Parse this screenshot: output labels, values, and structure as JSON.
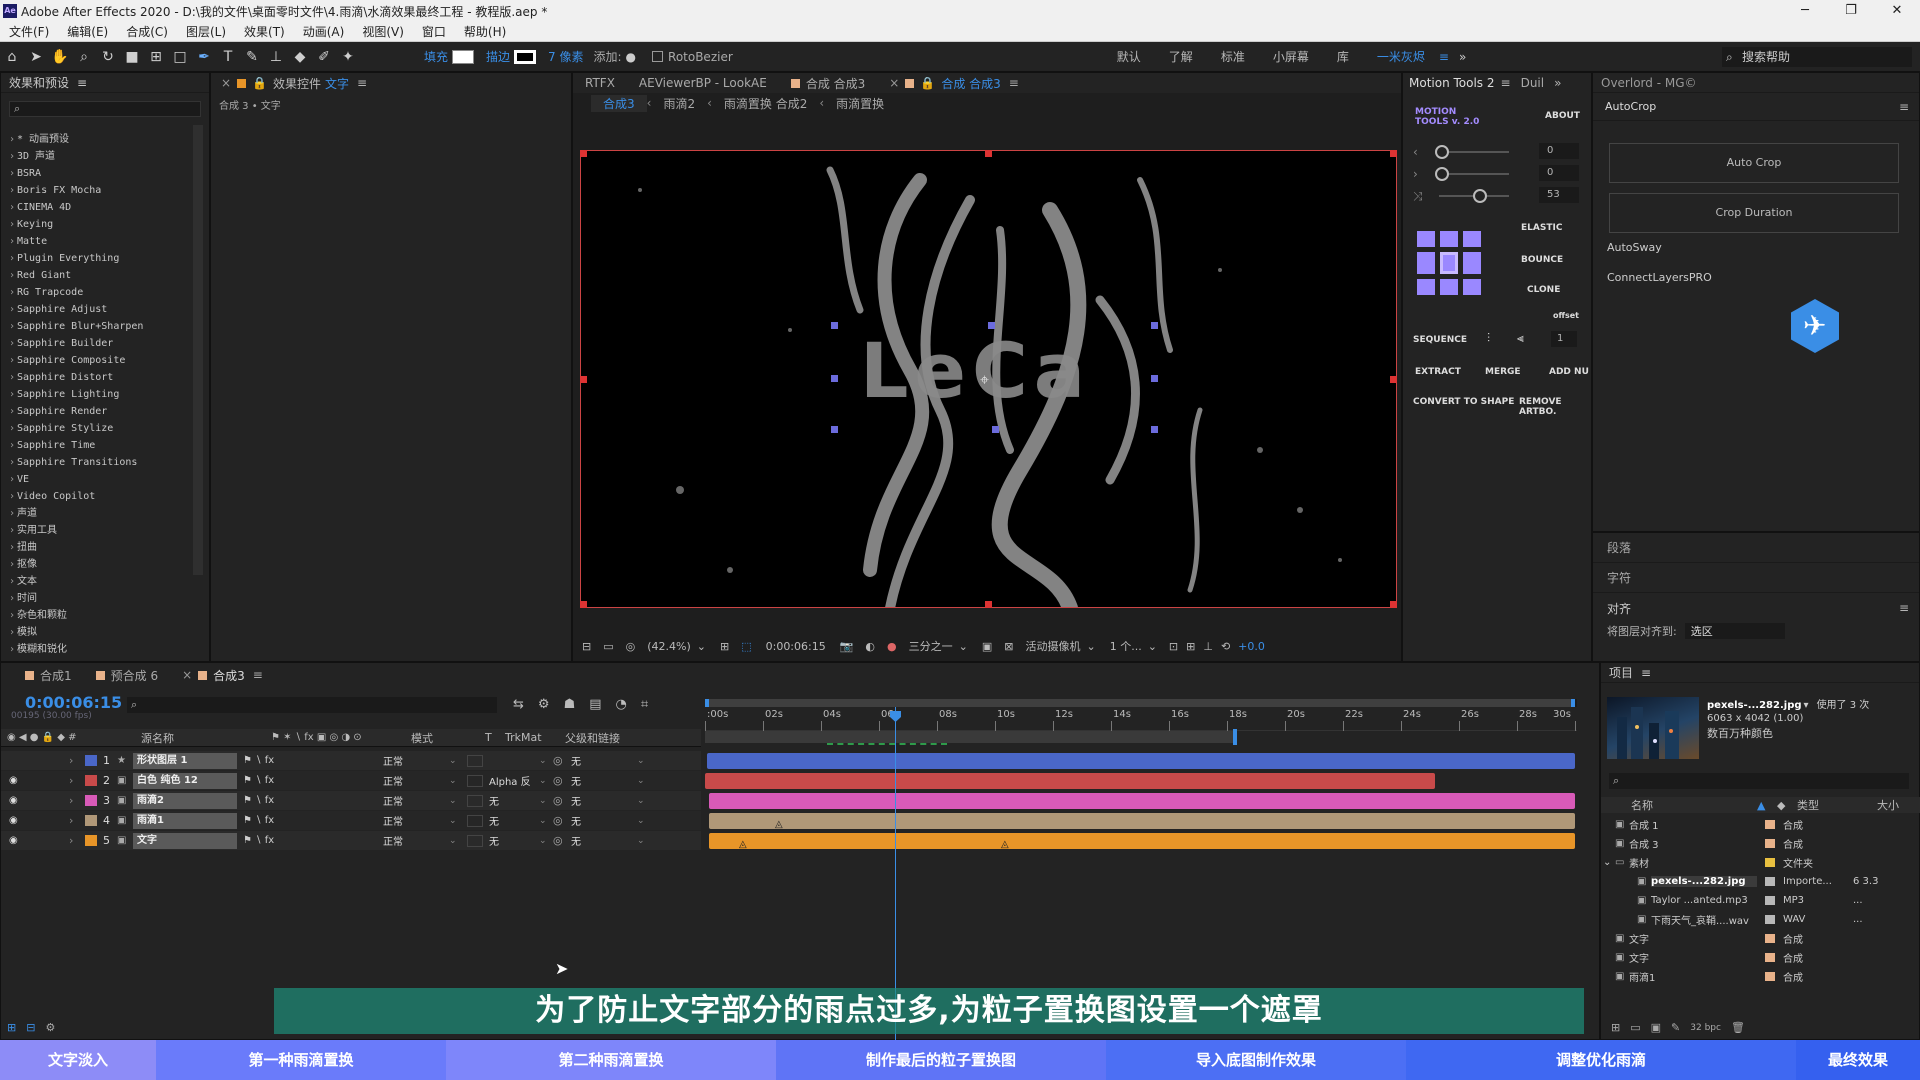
{
  "window": {
    "title": "Adobe After Effects 2020 - D:\\我的文件\\桌面零时文件\\4.雨滴\\水滴效果最终工程 - 教程版.aep *",
    "app_icon": "Ae"
  },
  "menu": [
    "文件(F)",
    "编辑(E)",
    "合成(C)",
    "图层(L)",
    "效果(T)",
    "动画(A)",
    "视图(V)",
    "窗口",
    "帮助(H)"
  ],
  "toolbar": {
    "fill_label": "填充",
    "stroke_label": "描边",
    "stroke_px": "7 像素",
    "add_label": "添加:",
    "rotobezier": "RotoBezier",
    "workspaces": [
      "默认",
      "了解",
      "标准",
      "小屏幕",
      "库",
      "一米灰烬"
    ],
    "active_workspace": "一米灰烬",
    "search_help": "搜索帮助"
  },
  "effects_panel": {
    "title": "效果和预设",
    "items": [
      "* 动画预设",
      "3D 声道",
      "BSRA",
      "Boris FX Mocha",
      "CINEMA 4D",
      "Keying",
      "Matte",
      "Plugin Everything",
      "Red Giant",
      "RG Trapcode",
      "Sapphire Adjust",
      "Sapphire Blur+Sharpen",
      "Sapphire Builder",
      "Sapphire Composite",
      "Sapphire Distort",
      "Sapphire Lighting",
      "Sapphire Render",
      "Sapphire Stylize",
      "Sapphire Time",
      "Sapphire Transitions",
      "VE",
      "Video Copilot",
      "声道",
      "实用工具",
      "扭曲",
      "抠像",
      "文本",
      "时间",
      "杂色和颗粒",
      "模拟",
      "模糊和锐化"
    ]
  },
  "effect_controls": {
    "title": "效果控件",
    "title_target": "文字",
    "breadcrumb": "合成 3 • 文字"
  },
  "viewer": {
    "tabs": [
      "RTFX",
      "AEViewerBP - LookAE",
      "合成 合成3",
      "合成 合成3"
    ],
    "active_tab": "合成 合成3",
    "breadcrumbs": [
      "合成3",
      "雨滴2",
      "雨滴置换 合成2",
      "雨滴置换"
    ],
    "zoom": "(42.4%)",
    "timecode": "0:00:06:15",
    "resolution": "三分之一",
    "camera": "活动摄像机",
    "views": "1 个...",
    "exposure": "+0.0",
    "text_in_view": "LeCa"
  },
  "motion_tools": {
    "title": "Motion Tools 2",
    "tab2": "Duil",
    "logo": "MOTION TOOLS v. 2.0",
    "about": "ABOUT",
    "sliders": [
      "0",
      "0",
      "53"
    ],
    "buttons": [
      "ELASTIC",
      "BOUNCE",
      "CLONE",
      "offset",
      "SEQUENCE",
      "EXTRACT",
      "MERGE",
      "ADD NU",
      "CONVERT TO SHAPE",
      "REMOVE ARTBO."
    ],
    "seq_value": "1"
  },
  "overlord": {
    "title": "Overlord - MG©",
    "autocrop": "AutoCrop",
    "auto_crop_btn": "Auto Crop",
    "crop_duration_btn": "Crop Duration",
    "autosway": "AutoSway",
    "connectlayers": "ConnectLayersPRO"
  },
  "side_panels": {
    "paragraph": "段落",
    "character": "字符",
    "align": "对齐",
    "align_to_label": "将图层对齐到:",
    "align_to_value": "选区"
  },
  "timeline": {
    "tabs": [
      "合成1",
      "预合成 6",
      "合成3"
    ],
    "active_tab": "合成3",
    "timecode": "0:00:06:15",
    "frame_info": "00195 (30.00 fps)",
    "columns": [
      "源名称",
      "模式",
      "T",
      "TrkMat",
      "父级和链接"
    ],
    "ruler": [
      ":00s",
      "02s",
      "04s",
      "06s",
      "08s",
      "10s",
      "12s",
      "14s",
      "16s",
      "18s",
      "20s",
      "22s",
      "24s",
      "26s",
      "28s",
      "30s"
    ],
    "layers": [
      {
        "num": "1",
        "name": "形状图层 1",
        "mode": "正常",
        "trkmat": "",
        "parent": "无",
        "color": "#4a67c8"
      },
      {
        "num": "2",
        "name": "白色 纯色 12",
        "mode": "正常",
        "trkmat": "Alpha 反",
        "parent": "无",
        "color": "#c84a4a"
      },
      {
        "num": "3",
        "name": "雨滴2",
        "mode": "正常",
        "trkmat": "无",
        "parent": "无",
        "color": "#d85ab8"
      },
      {
        "num": "4",
        "name": "雨滴1",
        "mode": "正常",
        "trkmat": "无",
        "parent": "无",
        "color": "#b09878"
      },
      {
        "num": "5",
        "name": "文字",
        "mode": "正常",
        "trkmat": "无",
        "parent": "无",
        "color": "#e89528"
      }
    ],
    "bpc": "32 bpc"
  },
  "project": {
    "title": "项目",
    "filename": "pexels-...282.jpg",
    "used_count": "使用了 3 次",
    "dims": "6063 x 4042 (1.00)",
    "colors": "数百万种颜色",
    "columns": [
      "名称",
      "类型",
      "大小"
    ],
    "rows": [
      {
        "name": "合成 1",
        "type": "合成",
        "size": ""
      },
      {
        "name": "合成 3",
        "type": "合成",
        "size": ""
      },
      {
        "name": "素材",
        "type": "文件夹",
        "size": ""
      },
      {
        "name": "pexels-...282.jpg",
        "type": "Importe...",
        "size": "6 3.3"
      },
      {
        "name": "Taylor ...anted.mp3",
        "type": "MP3",
        "size": "..."
      },
      {
        "name": "下雨天气_哀鞘....wav",
        "type": "WAV",
        "size": "..."
      },
      {
        "name": "文字",
        "type": "合成",
        "size": ""
      },
      {
        "name": "文字",
        "type": "合成",
        "size": ""
      },
      {
        "name": "雨滴1",
        "type": "合成",
        "size": ""
      }
    ]
  },
  "subtitle": "为了防止文字部分的雨点过多,为粒子置换图设置一个遮罩",
  "chapters": [
    "文字淡入",
    "第一种雨滴置换",
    "第二种雨滴置换",
    "制作最后的粒子置换图",
    "导入底图制作效果",
    "调整优化雨滴",
    "最终效果"
  ]
}
